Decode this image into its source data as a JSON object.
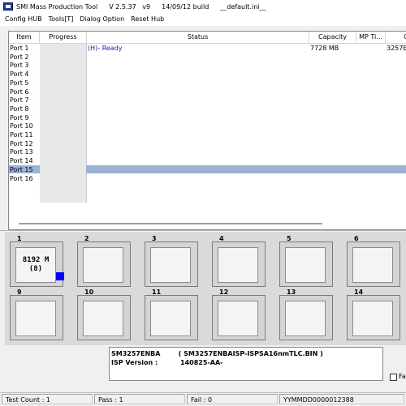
{
  "window": {
    "title_app": "SMI Mass Production Tool",
    "title_version": "V 2.5.37   v9",
    "title_build": "14/09/12 build",
    "title_ini": "__default.ini__"
  },
  "menu": [
    "Config HUB",
    "Tools[T]",
    "Dialog Option",
    "Reset Hub"
  ],
  "table": {
    "columns": [
      "Item",
      "Progress",
      "Status",
      "Capacity",
      "MP Ti...",
      "Ch"
    ],
    "rows": [
      {
        "item": "Port 1",
        "status": "(H)- Ready",
        "capacity": "7728 MB",
        "mp_time": "",
        "chip": "3257E"
      },
      {
        "item": "Port 2",
        "status": "",
        "capacity": "",
        "mp_time": "",
        "chip": ""
      },
      {
        "item": "Port 3",
        "status": "",
        "capacity": "",
        "mp_time": "",
        "chip": ""
      },
      {
        "item": "Port 4",
        "status": "",
        "capacity": "",
        "mp_time": "",
        "chip": ""
      },
      {
        "item": "Port 5",
        "status": "",
        "capacity": "",
        "mp_time": "",
        "chip": ""
      },
      {
        "item": "Port 6",
        "status": "",
        "capacity": "",
        "mp_time": "",
        "chip": ""
      },
      {
        "item": "Port 7",
        "status": "",
        "capacity": "",
        "mp_time": "",
        "chip": ""
      },
      {
        "item": "Port 8",
        "status": "",
        "capacity": "",
        "mp_time": "",
        "chip": ""
      },
      {
        "item": "Port 9",
        "status": "",
        "capacity": "",
        "mp_time": "",
        "chip": ""
      },
      {
        "item": "Port 10",
        "status": "",
        "capacity": "",
        "mp_time": "",
        "chip": ""
      },
      {
        "item": "Port 11",
        "status": "",
        "capacity": "",
        "mp_time": "",
        "chip": ""
      },
      {
        "item": "Port 12",
        "status": "",
        "capacity": "",
        "mp_time": "",
        "chip": ""
      },
      {
        "item": "Port 13",
        "status": "",
        "capacity": "",
        "mp_time": "",
        "chip": ""
      },
      {
        "item": "Port 14",
        "status": "",
        "capacity": "",
        "mp_time": "",
        "chip": ""
      },
      {
        "item": "Port 15",
        "status": "",
        "capacity": "",
        "mp_time": "",
        "chip": "",
        "selected": true
      },
      {
        "item": "Port 16",
        "status": "",
        "capacity": "",
        "mp_time": "",
        "chip": ""
      }
    ]
  },
  "slots": [
    {
      "number": "1",
      "line1": "8192 M",
      "line2": "(8)",
      "active": true
    },
    {
      "number": "2",
      "line1": "",
      "line2": ""
    },
    {
      "number": "3",
      "line1": "",
      "line2": ""
    },
    {
      "number": "4",
      "line1": "",
      "line2": ""
    },
    {
      "number": "5",
      "line1": "",
      "line2": ""
    },
    {
      "number": "6",
      "line1": "",
      "line2": ""
    },
    {
      "number": "9",
      "line1": "",
      "line2": ""
    },
    {
      "number": "10",
      "line1": "",
      "line2": ""
    },
    {
      "number": "11",
      "line1": "",
      "line2": ""
    },
    {
      "number": "12",
      "line1": "",
      "line2": ""
    },
    {
      "number": "13",
      "line1": "",
      "line2": ""
    },
    {
      "number": "14",
      "line1": "",
      "line2": ""
    }
  ],
  "info": {
    "line1": "SM3257ENBA        ( SM3257ENBAISP-ISPSA16nmTLC.BIN )",
    "line2": "ISP Version :          140825-AA-"
  },
  "checkbox_label": "Fa",
  "status": {
    "test_count": "Test Count : 1",
    "pass": "Pass : 1",
    "fail": "Fail : 0",
    "serial": "YYMMDD0000012388"
  },
  "colors": {
    "selection": "#9ab2d3",
    "status_text": "#1a1aa6",
    "indicator": "#0000ff"
  },
  "icons": {
    "app": "smi-app-icon"
  }
}
